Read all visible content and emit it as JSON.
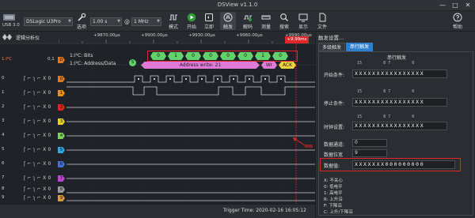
{
  "window": {
    "title": "DSView v1.1.0",
    "minimize": "—",
    "maximize": "□",
    "close": "✕"
  },
  "toolbar": {
    "device_label": "DSLogic U3Pro",
    "usb_label": "USB 3.0",
    "select_label": "选项",
    "time_value": "1.00 s",
    "freq_value": "1 MHz",
    "mode_label": "模式",
    "start_label": "开始",
    "instant_label": "立即",
    "trigger_label": "触发",
    "decode_label": "解码",
    "measure_label": "测量",
    "search_label": "搜索",
    "display_label": "显示",
    "file_label": "文件",
    "help_label": "帮助"
  },
  "tabs": {
    "logic_analyzer": "逻辑分析仪"
  },
  "ruler": {
    "labels": [
      "+9870.00μs",
      "+9900.00μs",
      "+9930.00μs",
      "+9960.00μs",
      "+9990.00μs"
    ],
    "cursor_label": "+9.99ms"
  },
  "channels": {
    "decoder_name": "1:I²C",
    "decoder_tag": "0,1",
    "decoder_tag_letter": "D",
    "rows": [
      {
        "label": "0",
        "tag": "0",
        "color": "#e07820"
      },
      {
        "label": "1",
        "tag": "1",
        "color": "#f08c18"
      },
      {
        "label": "2",
        "tag": "2",
        "color": "#e52020"
      },
      {
        "label": "3",
        "tag": "3",
        "color": "#e8d420"
      },
      {
        "label": "4",
        "tag": "4",
        "color": "#7fd35a"
      },
      {
        "label": "5",
        "tag": "5",
        "color": "#30a8e0"
      },
      {
        "label": "6",
        "tag": "6",
        "color": "#4a6ed8"
      },
      {
        "label": "7",
        "tag": "7",
        "color": "#bd44d0"
      },
      {
        "label": "8",
        "tag": "8",
        "color": "#9a9a9a"
      },
      {
        "label": "9",
        "tag": "9",
        "color": "#d89a40"
      }
    ],
    "trigger_symbol": "ʃ ⌐ ʅ ⌐ X 0"
  },
  "decode": {
    "bits_label": "1:I²C: Bits",
    "addr_label": "1:I²C: Address/Data",
    "start_marker": "S",
    "bits": [
      "0",
      "1",
      "0",
      "0",
      "0",
      "0",
      "1",
      "0"
    ],
    "address_text": "Address write: 21",
    "wr_text": "Wr",
    "ack_text": "ACK"
  },
  "status": {
    "trigger_time": "Trigger Time: 2020-02-16 16:05:12"
  },
  "panel": {
    "title": "触发设置...",
    "tab_multi": "多级触发",
    "tab_serial": "串行触发",
    "section_title": "串行触发",
    "start_label": "开始条件:",
    "stop_label": "停止条件:",
    "clock_label": "时钟设置:",
    "data_channel_label": "数据通道:",
    "data_channel_value": "0",
    "data_width_label": "数据位宽",
    "data_width_value": "9",
    "data_label": "数据值:",
    "start_bits": "XXXXXXXXXXXXXXXX",
    "stop_bits": "XXXXXXXXXXXXXXXX",
    "clock_bits": "XXXXXXXXXXXXXXXX",
    "data_bits": "XXXXXXX000000000",
    "bit_index_row": "15         8 7         0",
    "legend": [
      "X: 不关心",
      "0: 低电平",
      "1: 高电平",
      "R: 上升沿",
      "F: 下降沿",
      "C: 上升/下降沿"
    ]
  },
  "colors": {
    "accent_red": "#e0262a",
    "decode_green": "#62d36c",
    "decode_pink": "#e07ad8",
    "ack_yellow": "#ecd23c"
  }
}
